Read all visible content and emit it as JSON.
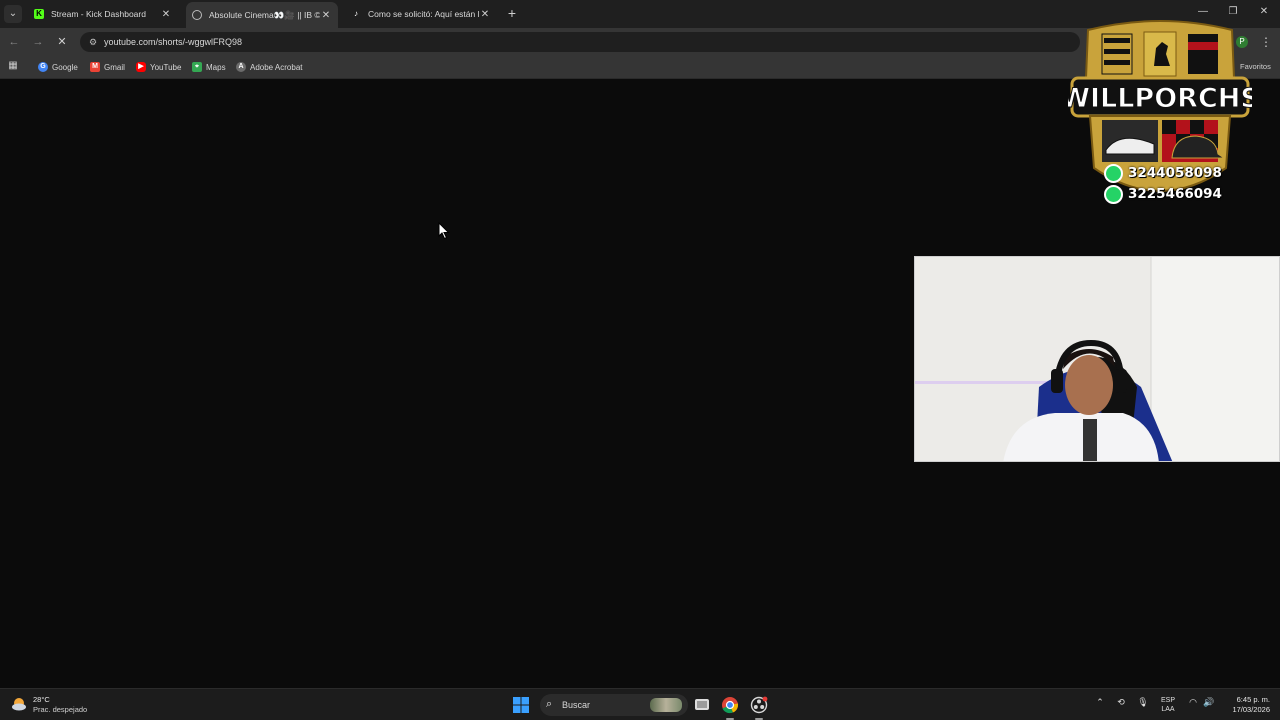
{
  "browser": {
    "tabs": [
      {
        "title": "Stream - Kick Dashboard",
        "favicon": "kick-logo-icon",
        "active": false
      },
      {
        "title": "Absolute Cinema👀🎥 || IB ©",
        "favicon": "webpage-icon",
        "active": true
      },
      {
        "title": "Como se solicitó: Aquí están la",
        "favicon": "tiktok-icon",
        "active": false
      }
    ],
    "new_tab": "+",
    "window_controls": {
      "minimize": "—",
      "maximize": "❐",
      "close": "✕"
    },
    "url": "youtube.com/shorts/-wggwlFRQ98",
    "profile_initial": "P",
    "bookmarks": [
      {
        "label": "Google",
        "icon": "google-icon",
        "color": "#4285f4"
      },
      {
        "label": "Gmail",
        "icon": "gmail-icon",
        "color": "#ea4335"
      },
      {
        "label": "YouTube",
        "icon": "youtube-icon",
        "color": "#ff0000"
      },
      {
        "label": "Maps",
        "icon": "maps-icon",
        "color": "#34a853"
      },
      {
        "label": "Adobe Acrobat",
        "icon": "acrobat-icon",
        "color": "#6b6b6b"
      }
    ],
    "bookmarks_right": "Favoritos"
  },
  "overlay": {
    "brand": "WILLPORCHS",
    "phones": [
      "3244058098",
      "3225466094"
    ],
    "brand_colors": {
      "gold": "#c9a33b",
      "black": "#111111",
      "red": "#b3121b"
    }
  },
  "taskbar": {
    "weather": {
      "temp": "28°C",
      "desc": "Prac. despejado"
    },
    "search_label": "Buscar",
    "lang": [
      "ESP",
      "LAA"
    ],
    "time": "6:45 p. m.",
    "date": "17/03/2026"
  }
}
